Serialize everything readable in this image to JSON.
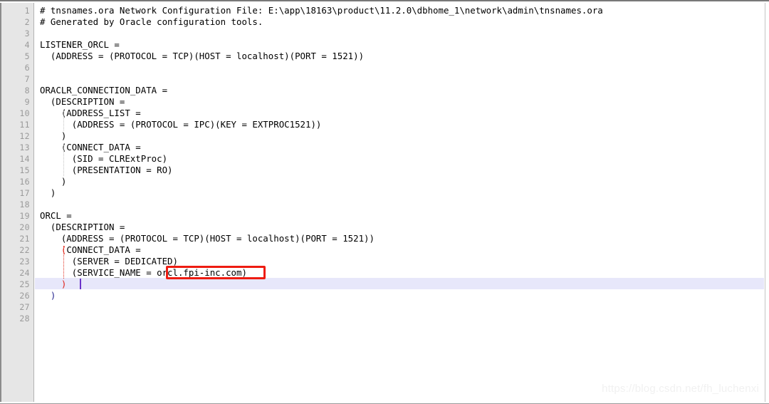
{
  "editor": {
    "file_name": "tnsnames.ora",
    "language": "oracle-tns",
    "total_lines": 28,
    "current_line": 25,
    "caret_column": 7,
    "gutter_background": "#e6e6e6",
    "line_number_color": "#9a9a9a",
    "current_line_highlight_color": "#e7e7fa",
    "bracket_match_color": "#e02015",
    "text_color": "#000000",
    "background": "#ffffff"
  },
  "lines": [
    {
      "number": "1",
      "text": "# tnsnames.ora Network Configuration File: E:\\app\\18163\\product\\11.2.0\\dbhome_1\\network\\admin\\tnsnames.ora"
    },
    {
      "number": "2",
      "text": "# Generated by Oracle configuration tools."
    },
    {
      "number": "3",
      "text": ""
    },
    {
      "number": "4",
      "text": "LISTENER_ORCL ="
    },
    {
      "number": "5",
      "text": "  (ADDRESS = (PROTOCOL = TCP)(HOST = localhost)(PORT = 1521))"
    },
    {
      "number": "6",
      "text": ""
    },
    {
      "number": "7",
      "text": ""
    },
    {
      "number": "8",
      "text": "ORACLR_CONNECTION_DATA ="
    },
    {
      "number": "9",
      "text": "  (DESCRIPTION ="
    },
    {
      "number": "10",
      "text": "    (ADDRESS_LIST ="
    },
    {
      "number": "11",
      "text": "      (ADDRESS = (PROTOCOL = IPC)(KEY = EXTPROC1521))"
    },
    {
      "number": "12",
      "text": "    )"
    },
    {
      "number": "13",
      "text": "    (CONNECT_DATA ="
    },
    {
      "number": "14",
      "text": "      (SID = CLRExtProc)"
    },
    {
      "number": "15",
      "text": "      (PRESENTATION = RO)"
    },
    {
      "number": "16",
      "text": "    )"
    },
    {
      "number": "17",
      "text": "  )"
    },
    {
      "number": "18",
      "text": ""
    },
    {
      "number": "19",
      "text": "ORCL ="
    },
    {
      "number": "20",
      "text": "  (DESCRIPTION ="
    },
    {
      "number": "21",
      "text": "    (ADDRESS = (PROTOCOL = TCP)(HOST = localhost)(PORT = 1521))"
    },
    {
      "number": "22",
      "text": "    (CONNECT_DATA =",
      "bracket_open": true
    },
    {
      "number": "23",
      "text": "      (SERVER = DEDICATED)"
    },
    {
      "number": "24",
      "text": "      (SERVICE_NAME = orcl.fpi-inc.com)"
    },
    {
      "number": "25",
      "text": "    )",
      "bracket_close": true,
      "is_current": true
    },
    {
      "number": "26",
      "text": "  )",
      "bracket_blue": true
    },
    {
      "number": "27",
      "text": ""
    },
    {
      "number": "28",
      "text": ""
    }
  ],
  "annotation": {
    "label": "orcl.fpi-inc.com",
    "color": "#ee1c11",
    "target_line": "24"
  },
  "watermark": {
    "text": "https://blog.csdn.net/fh_luchenxi"
  }
}
